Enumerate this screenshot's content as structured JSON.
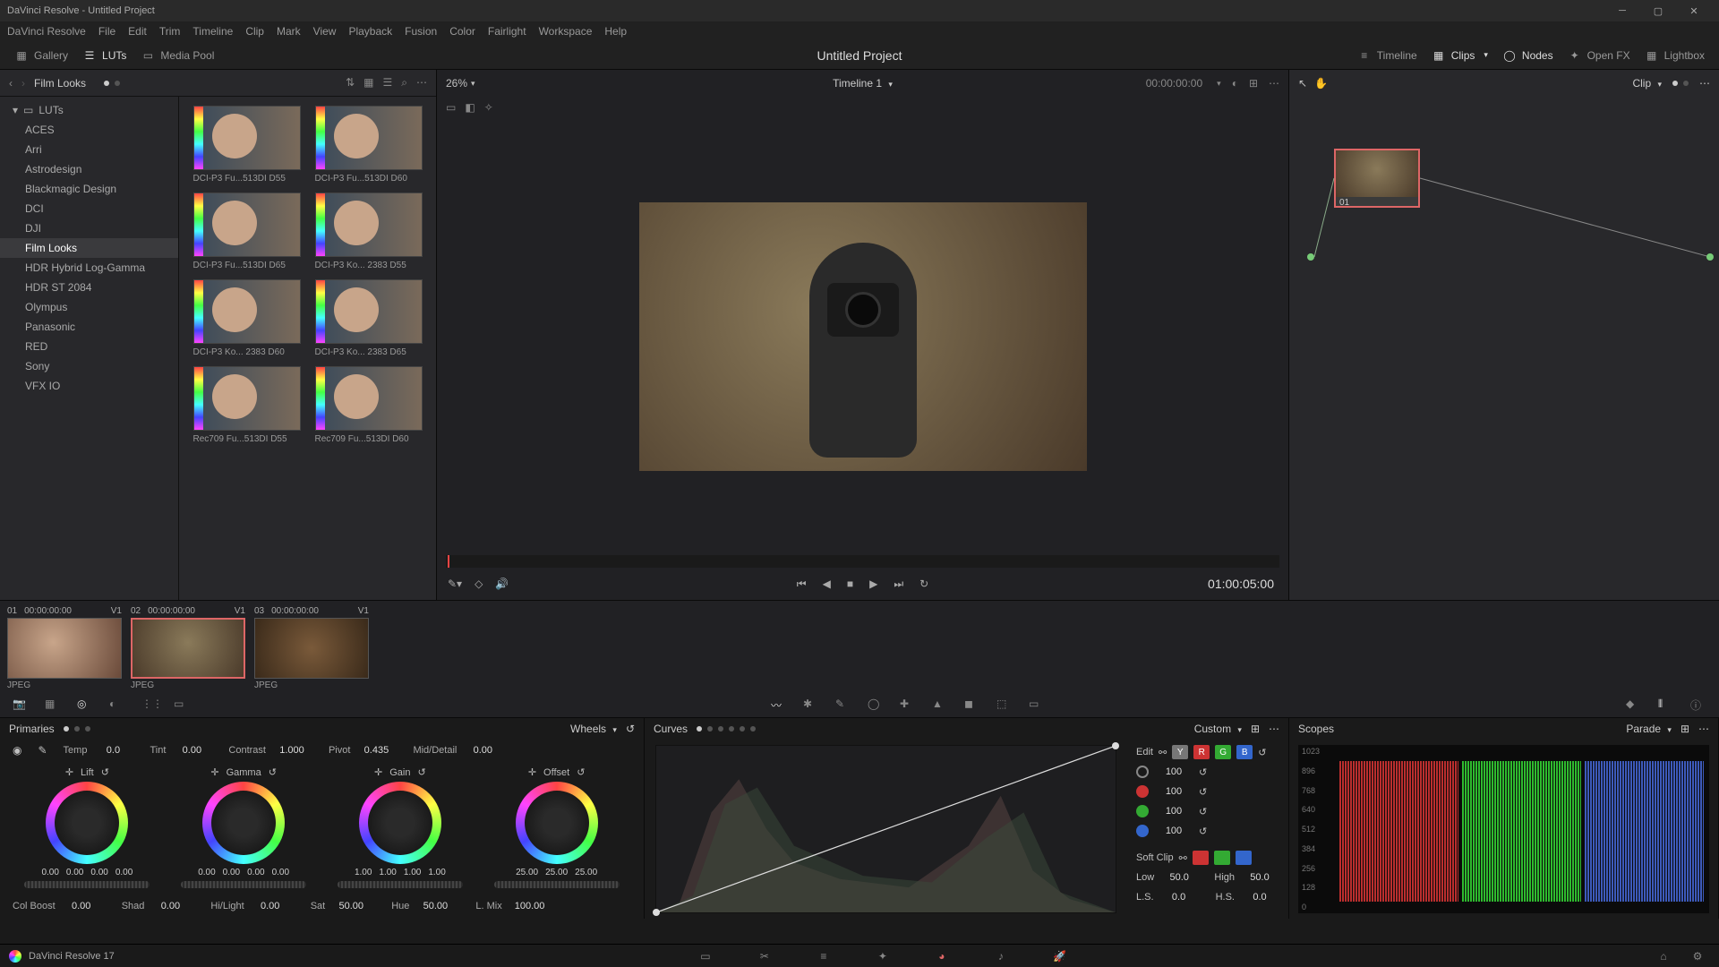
{
  "title_bar": "DaVinci Resolve - Untitled Project",
  "menu": [
    "DaVinci Resolve",
    "File",
    "Edit",
    "Trim",
    "Timeline",
    "Clip",
    "Mark",
    "View",
    "Playback",
    "Fusion",
    "Color",
    "Fairlight",
    "Workspace",
    "Help"
  ],
  "top_toolbar": {
    "gallery": "Gallery",
    "luts": "LUTs",
    "media_pool": "Media Pool",
    "project": "Untitled Project",
    "timeline": "Timeline",
    "clips": "Clips",
    "nodes": "Nodes",
    "openfx": "Open FX",
    "lightbox": "Lightbox"
  },
  "luts_panel": {
    "title": "Film Looks",
    "root": "LUTs",
    "categories": [
      "ACES",
      "Arri",
      "Astrodesign",
      "Blackmagic Design",
      "DCI",
      "DJI",
      "Film Looks",
      "HDR Hybrid Log-Gamma",
      "HDR ST 2084",
      "Olympus",
      "Panasonic",
      "RED",
      "Sony",
      "VFX IO"
    ],
    "active_category": "Film Looks",
    "thumbs": [
      "DCI-P3 Fu...513DI D55",
      "DCI-P3 Fu...513DI D60",
      "DCI-P3 Fu...513DI D65",
      "DCI-P3 Ko... 2383 D55",
      "DCI-P3 Ko... 2383 D60",
      "DCI-P3 Ko... 2383 D65",
      "Rec709 Fu...513DI D55",
      "Rec709 Fu...513DI D60"
    ]
  },
  "viewer": {
    "zoom": "26%",
    "timeline_name": "Timeline 1",
    "timecode_head": "00:00:00:00",
    "timecode_current": "01:00:05:00"
  },
  "nodes": {
    "mode": "Clip",
    "node_label": "01"
  },
  "clips": [
    {
      "idx": "01",
      "tc": "00:00:00:00",
      "track": "V1",
      "type": "JPEG",
      "sel": false
    },
    {
      "idx": "02",
      "tc": "00:00:00:00",
      "track": "V1",
      "type": "JPEG",
      "sel": true
    },
    {
      "idx": "03",
      "tc": "00:00:00:00",
      "track": "V1",
      "type": "JPEG",
      "sel": false
    }
  ],
  "primaries": {
    "title": "Primaries",
    "mode": "Wheels",
    "temp": {
      "label": "Temp",
      "val": "0.0"
    },
    "tint": {
      "label": "Tint",
      "val": "0.00"
    },
    "contrast": {
      "label": "Contrast",
      "val": "1.000"
    },
    "pivot": {
      "label": "Pivot",
      "val": "0.435"
    },
    "middetail": {
      "label": "Mid/Detail",
      "val": "0.00"
    },
    "wheels": [
      {
        "name": "Lift",
        "nums": [
          "0.00",
          "0.00",
          "0.00",
          "0.00"
        ]
      },
      {
        "name": "Gamma",
        "nums": [
          "0.00",
          "0.00",
          "0.00",
          "0.00"
        ]
      },
      {
        "name": "Gain",
        "nums": [
          "1.00",
          "1.00",
          "1.00",
          "1.00"
        ]
      },
      {
        "name": "Offset",
        "nums": [
          "25.00",
          "25.00",
          "25.00"
        ]
      }
    ],
    "bottom": {
      "colboost": {
        "label": "Col Boost",
        "val": "0.00"
      },
      "shad": {
        "label": "Shad",
        "val": "0.00"
      },
      "hilight": {
        "label": "Hi/Light",
        "val": "0.00"
      },
      "sat": {
        "label": "Sat",
        "val": "50.00"
      },
      "hue": {
        "label": "Hue",
        "val": "50.00"
      },
      "lmix": {
        "label": "L. Mix",
        "val": "100.00"
      }
    }
  },
  "curves": {
    "title": "Curves",
    "mode": "Custom",
    "edit_label": "Edit",
    "channels": [
      {
        "val": "100"
      },
      {
        "val": "100"
      },
      {
        "val": "100"
      },
      {
        "val": "100"
      }
    ],
    "softclip_label": "Soft Clip",
    "low": {
      "label": "Low",
      "val": "50.0"
    },
    "high": {
      "label": "High",
      "val": "50.0"
    },
    "ls": {
      "label": "L.S.",
      "val": "0.0"
    },
    "hs": {
      "label": "H.S.",
      "val": "0.0"
    }
  },
  "scopes": {
    "title": "Scopes",
    "mode": "Parade",
    "scale": [
      "1023",
      "896",
      "768",
      "640",
      "512",
      "384",
      "256",
      "128",
      "0"
    ]
  },
  "footer": {
    "app": "DaVinci Resolve 17"
  }
}
